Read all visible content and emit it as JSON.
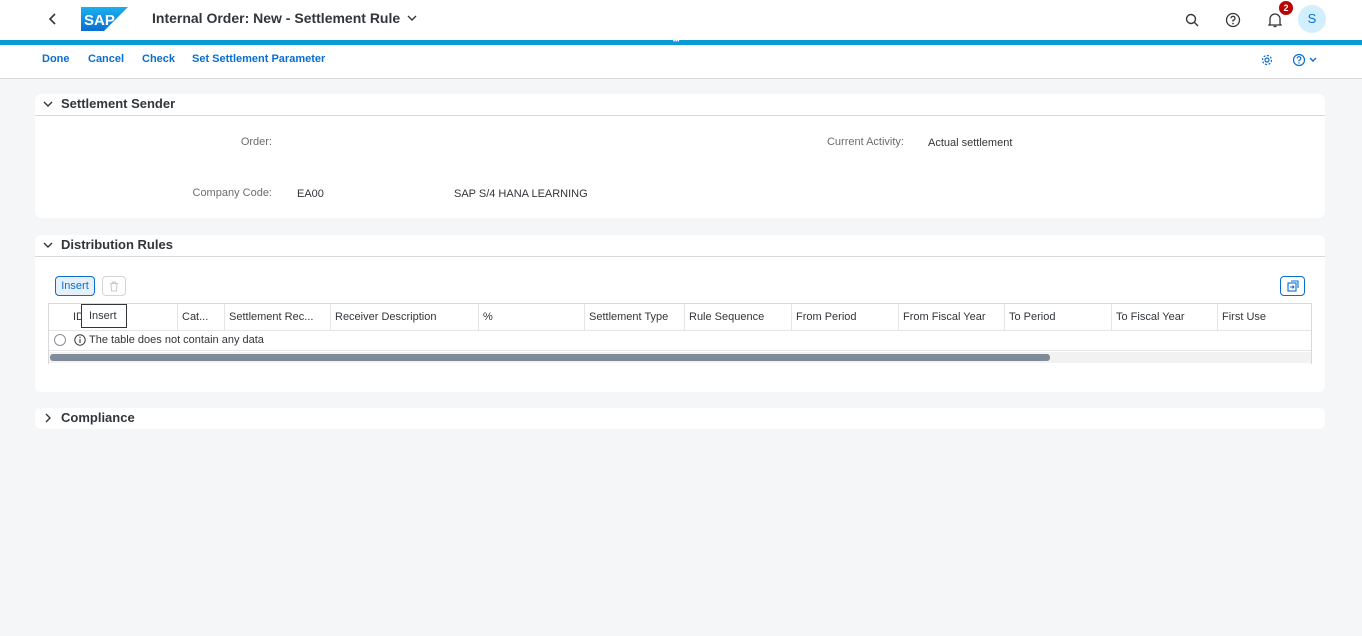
{
  "shell": {
    "title": "Internal Order: New - Settlement Rule",
    "logo_text": "SAP",
    "notification_count": "2",
    "avatar_initial": "S"
  },
  "toolbar": {
    "done": "Done",
    "cancel": "Cancel",
    "check": "Check",
    "set_param": "Set Settlement Parameter"
  },
  "sender": {
    "title": "Settlement Sender",
    "order_label": "Order:",
    "activity_label": "Current Activity:",
    "activity_value": "Actual settlement",
    "company_label": "Company Code:",
    "company_code": "EA00",
    "company_name": "SAP S/4 HANA LEARNING"
  },
  "distribution": {
    "title": "Distribution Rules",
    "insert_label": "Insert",
    "tooltip": "Insert",
    "columns": [
      "ID",
      "Cat...",
      "Settlement Rec...",
      "Receiver Description",
      "%",
      "Settlement Type",
      "Rule Sequence",
      "From Period",
      "From Fiscal Year",
      "To Period",
      "To Fiscal Year",
      "First Use"
    ],
    "empty_text": "The table does not contain any data"
  },
  "compliance": {
    "title": "Compliance"
  },
  "colors": {
    "accent": "#0a6ed1",
    "header_bar": "#0a9bd6",
    "badge": "#bb0000"
  }
}
